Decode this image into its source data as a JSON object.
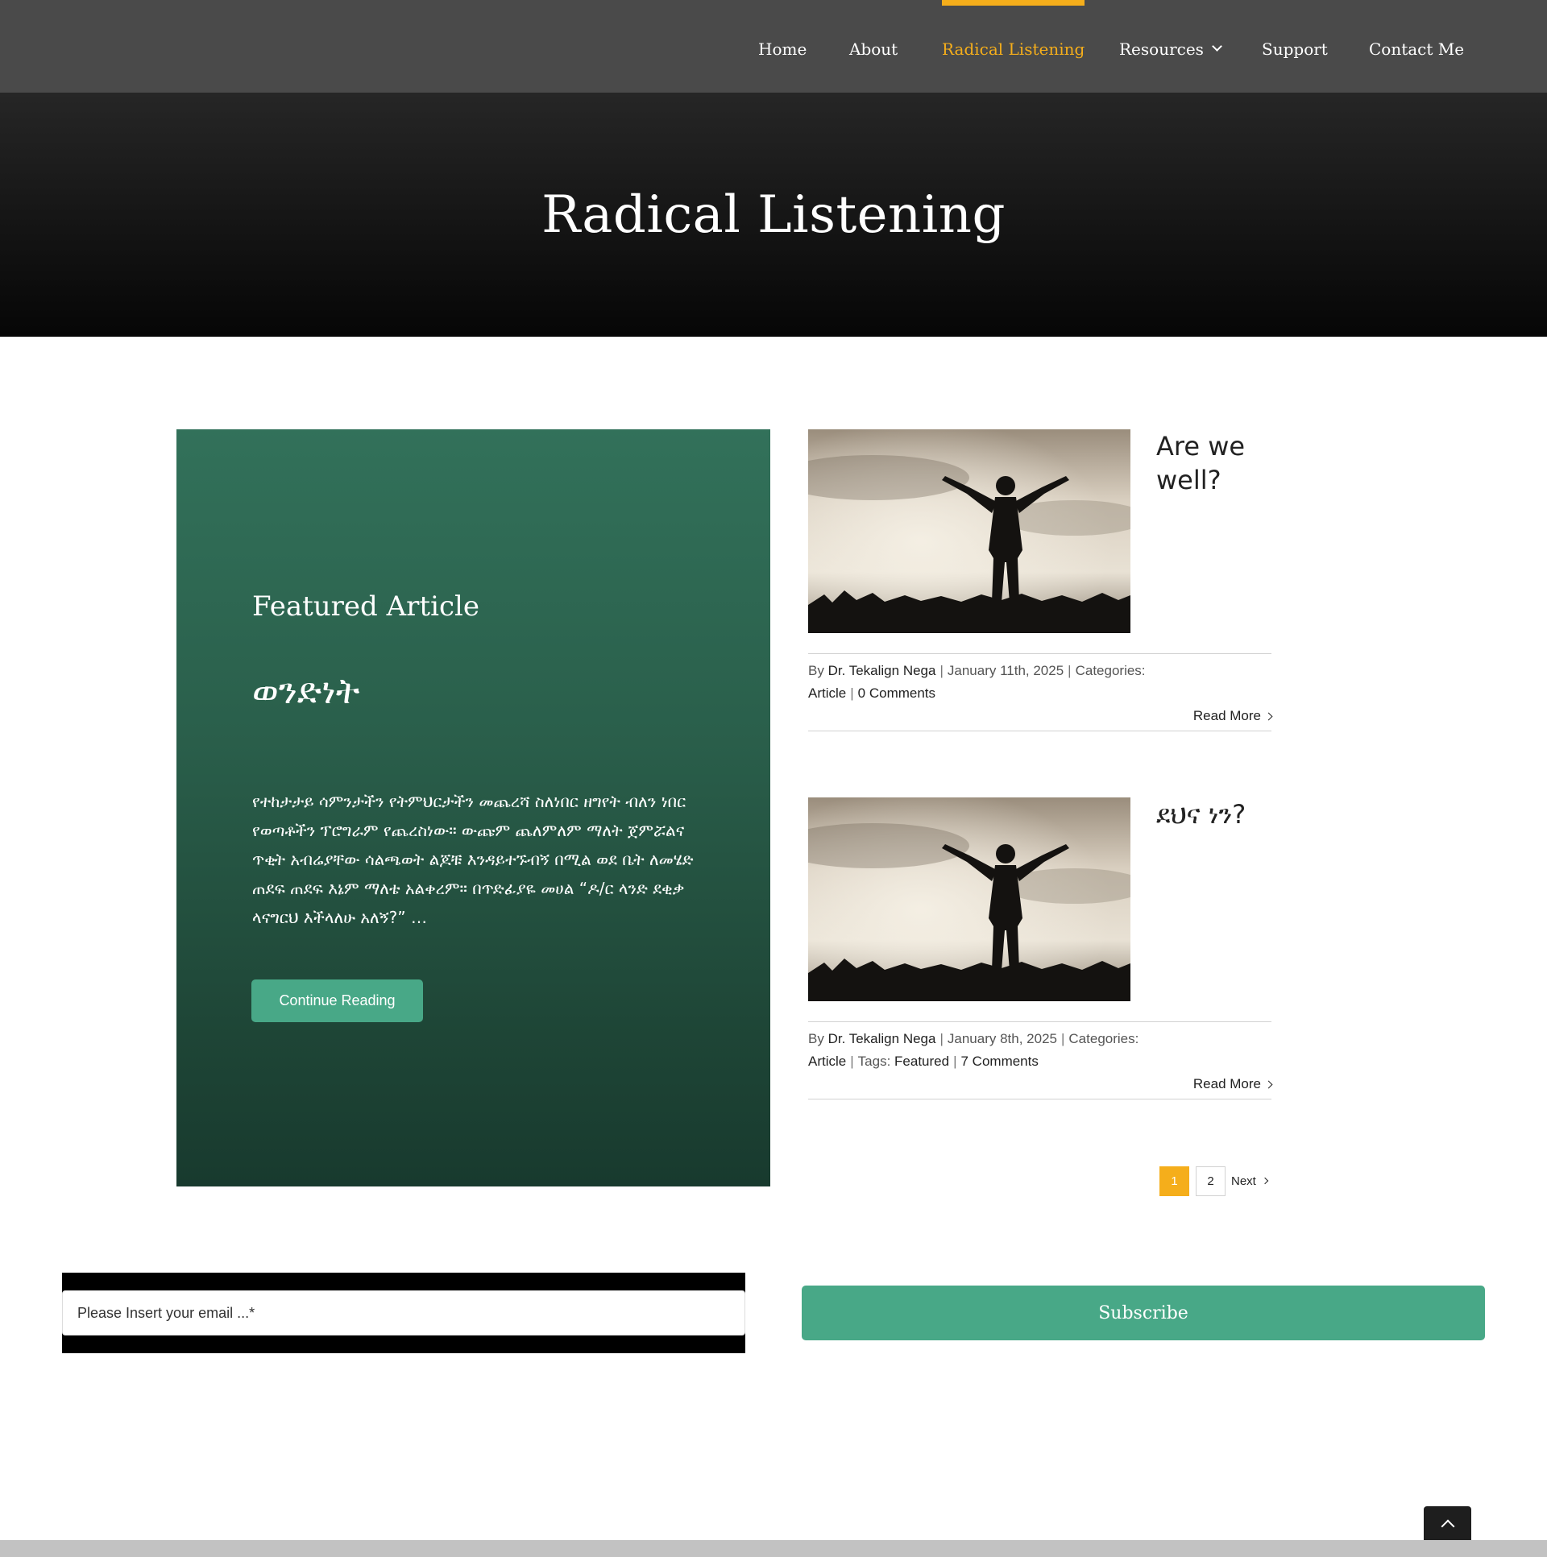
{
  "nav": {
    "items": [
      {
        "label": "Home"
      },
      {
        "label": "About"
      },
      {
        "label": "Radical Listening",
        "active": true
      },
      {
        "label": "Resources",
        "has_dropdown": true
      },
      {
        "label": "Support"
      },
      {
        "label": "Contact Me"
      }
    ],
    "accent_color": "#f5ae1b"
  },
  "hero": {
    "title": "Radical Listening"
  },
  "featured": {
    "kicker": "Featured Article",
    "title": "ወንድነት",
    "excerpt": "የተከታታይ ሳምንታችን የትምህርታችን መጨረሻ ስለነበር ዘግየት ብለን ነበር የወጣቶችን ፕሮግራም የጨረስነው። ውጩም ጨለምለም ማለት ጀምሯልና ጥቂት አብሬያቸው ሳልጫወት ልጆቹ እንዳይተኙብኝ በሚል ወደ ቤት ለመሄድ ጠደፍ ጠደፍ እኔም ማለቴ አልቀረም። በጥድፊያዬ መሀል “ዶ/ር ላንድ ደቂቃ ላናግርህ እችላለሁ አለኝ?” …",
    "button": "Continue Reading",
    "bg_color": "#2a5f4b"
  },
  "posts": [
    {
      "title": "Are we well?",
      "image_icon": "man-arms-raised-silhouette",
      "by": "By",
      "author": "Dr. Tekalign Nega",
      "date": "January 11th, 2025",
      "categories_label": "Categories:",
      "category": "Article",
      "comments": "0 Comments",
      "read_more": "Read More"
    },
    {
      "title": "ደህና ነን?",
      "image_icon": "man-arms-raised-silhouette",
      "by": "By",
      "author": "Dr. Tekalign Nega",
      "date": "January 8th, 2025",
      "categories_label": "Categories:",
      "category": "Article",
      "tags_label": "Tags:",
      "tag": "Featured",
      "comments": "7 Comments",
      "read_more": "Read More"
    }
  ],
  "pagination": {
    "pages": [
      "1",
      "2"
    ],
    "current": "1",
    "next": "Next"
  },
  "subscribe": {
    "placeholder": "Please Insert your email ...*",
    "button": "Subscribe",
    "button_color": "#48a887"
  },
  "back_to_top_icon": "chevron-up-icon"
}
